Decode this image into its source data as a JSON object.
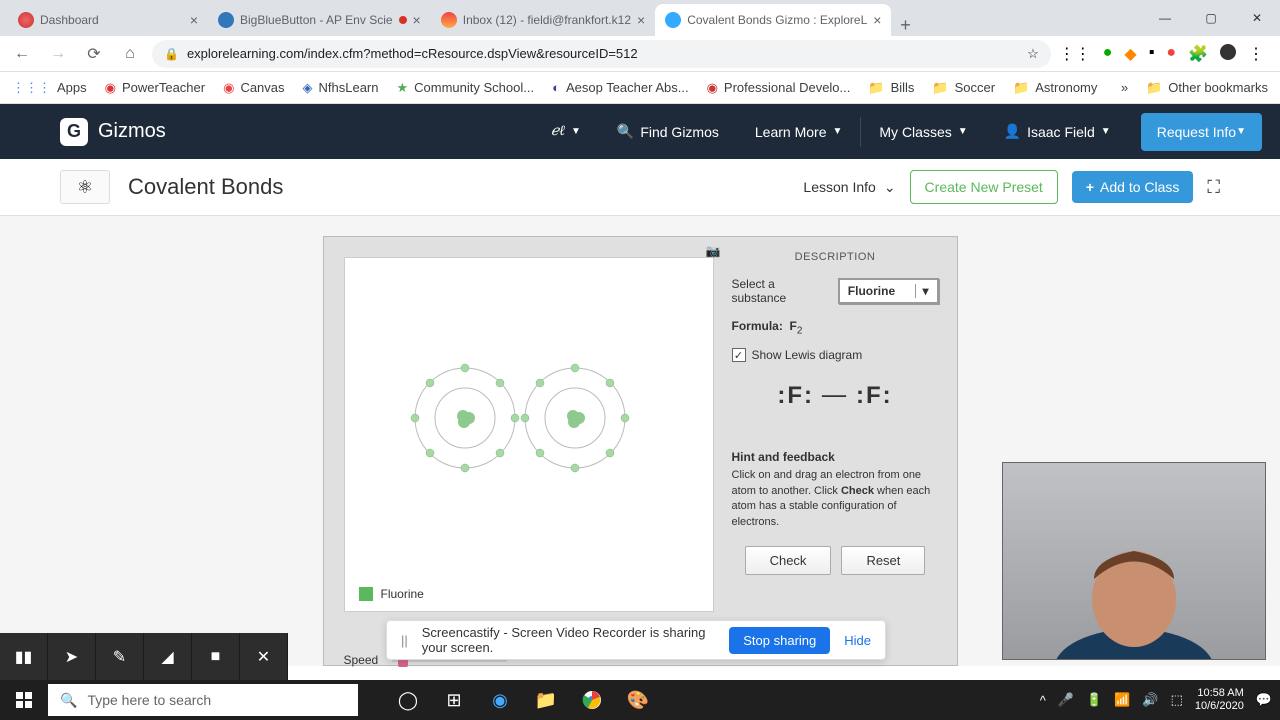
{
  "tabs": [
    {
      "title": "Dashboard",
      "favicon": "#d44"
    },
    {
      "title": "BigBlueButton - AP Env Scie",
      "favicon": "#336",
      "rec": true
    },
    {
      "title": "Inbox (12) - fieldi@frankfort.k12",
      "favicon": "#d44"
    },
    {
      "title": "Covalent Bonds Gizmo : ExploreL",
      "favicon": "#3af",
      "active": true
    }
  ],
  "url": "explorelearning.com/index.cfm?method=cResource.dspView&resourceID=512",
  "bookmarks": [
    "Apps",
    "PowerTeacher",
    "Canvas",
    "NfhsLearn",
    "Community School...",
    "Aesop Teacher Abs...",
    "Professional Develo...",
    "Bills",
    "Soccer",
    "Astronomy"
  ],
  "other_bookmarks": "Other bookmarks",
  "header": {
    "logo_letter": "G",
    "logo_text": "Gizmos",
    "find": "Find Gizmos",
    "learn": "Learn More",
    "classes": "My Classes",
    "user": "Isaac Field",
    "request": "Request Info"
  },
  "lesson": {
    "title": "Covalent Bonds",
    "info": "Lesson Info",
    "preset": "Create New Preset",
    "add": "Add to Class"
  },
  "gizmo": {
    "desc_title": "DESCRIPTION",
    "select_label": "Select a substance",
    "substance": "Fluorine",
    "formula_label": "Formula:",
    "formula": "F",
    "formula_sub": "2",
    "lewis_label": "Show Lewis diagram",
    "lewis_diagram": "F — F",
    "hint_title": "Hint and feedback",
    "hint_text_1": "Click on and drag an electron from one atom to another. Click ",
    "hint_check": "Check",
    "hint_text_2": " when each atom has a stable configuration of electrons.",
    "check": "Check",
    "reset": "Reset",
    "legend": "Fluorine",
    "speed": "Speed"
  },
  "screencastify": {
    "msg": "Screencastify - Screen Video Recorder is sharing your screen.",
    "stop": "Stop sharing",
    "hide": "Hide"
  },
  "taskbar": {
    "search_placeholder": "Type here to search",
    "time": "10:58 AM",
    "date": "10/6/2020"
  }
}
